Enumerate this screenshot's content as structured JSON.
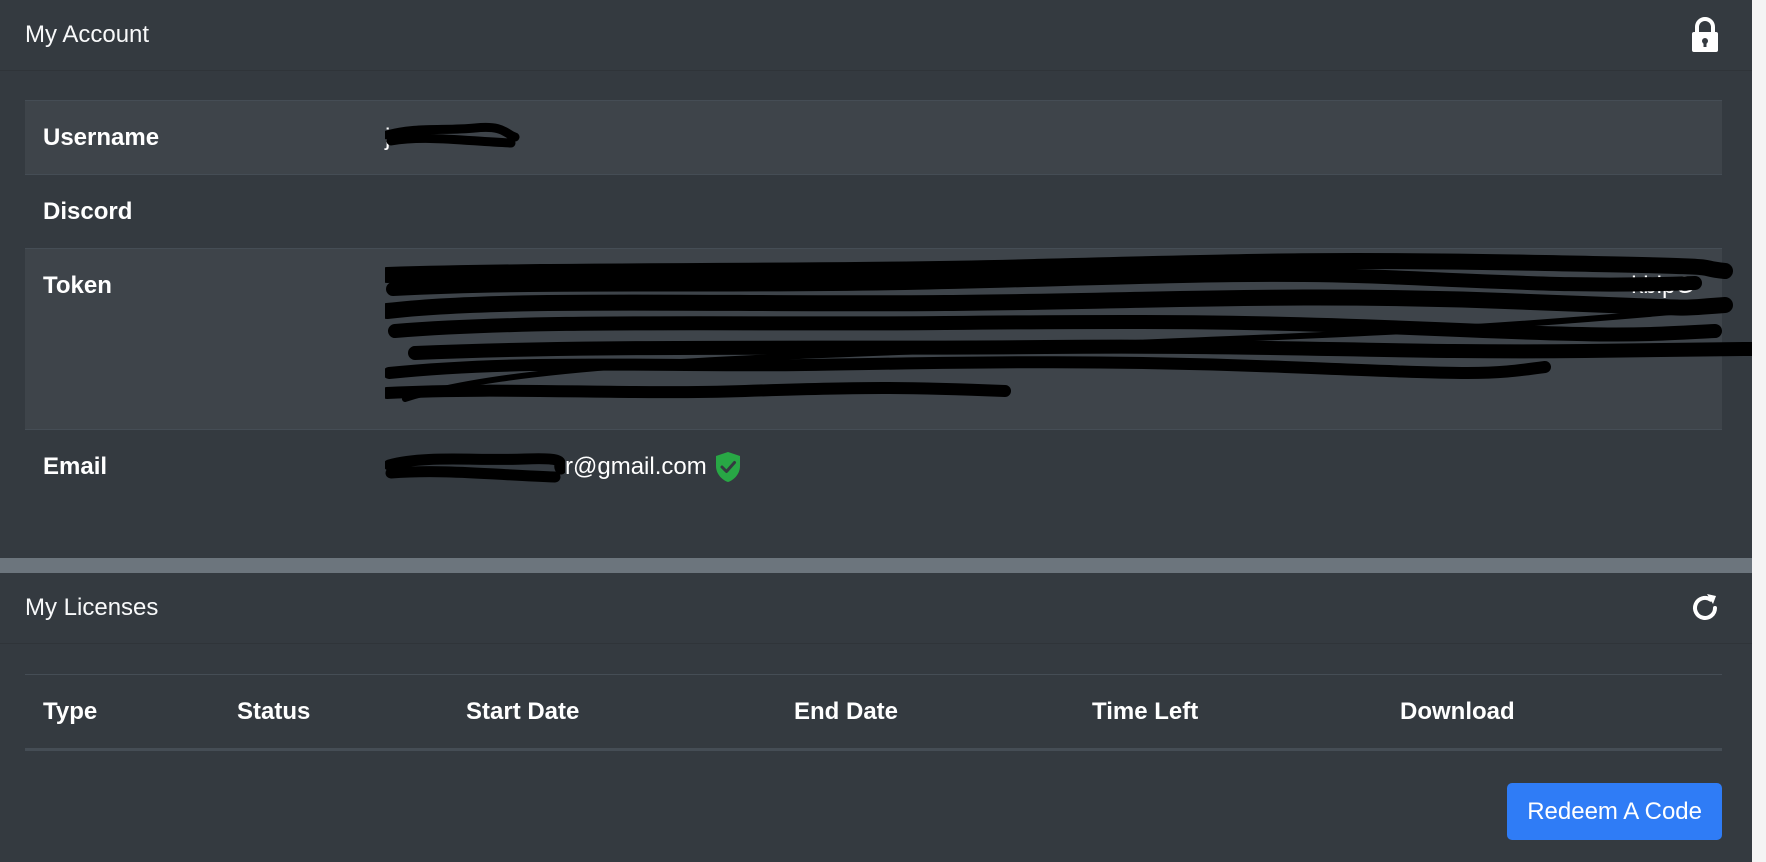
{
  "account": {
    "title": "My Account",
    "lock_icon": "lock-icon",
    "rows": {
      "username": {
        "label": "Username",
        "value": "j"
      },
      "discord": {
        "label": "Discord",
        "value": ""
      },
      "token": {
        "label": "Token",
        "value": "kbipG"
      },
      "email": {
        "label": "Email",
        "value": "r@gmail.com",
        "verified_icon": "shield-check-icon"
      }
    }
  },
  "licenses": {
    "title": "My Licenses",
    "refresh_icon": "refresh-icon",
    "columns": [
      "Type",
      "Status",
      "Start Date",
      "End Date",
      "Time Left",
      "Download"
    ],
    "redeem_label": "Redeem A Code"
  },
  "colors": {
    "background": "#343a40",
    "separator": "#6c757d",
    "stripe": "#3e444a",
    "accent": "#2f7cf6",
    "verified": "#28a745"
  }
}
